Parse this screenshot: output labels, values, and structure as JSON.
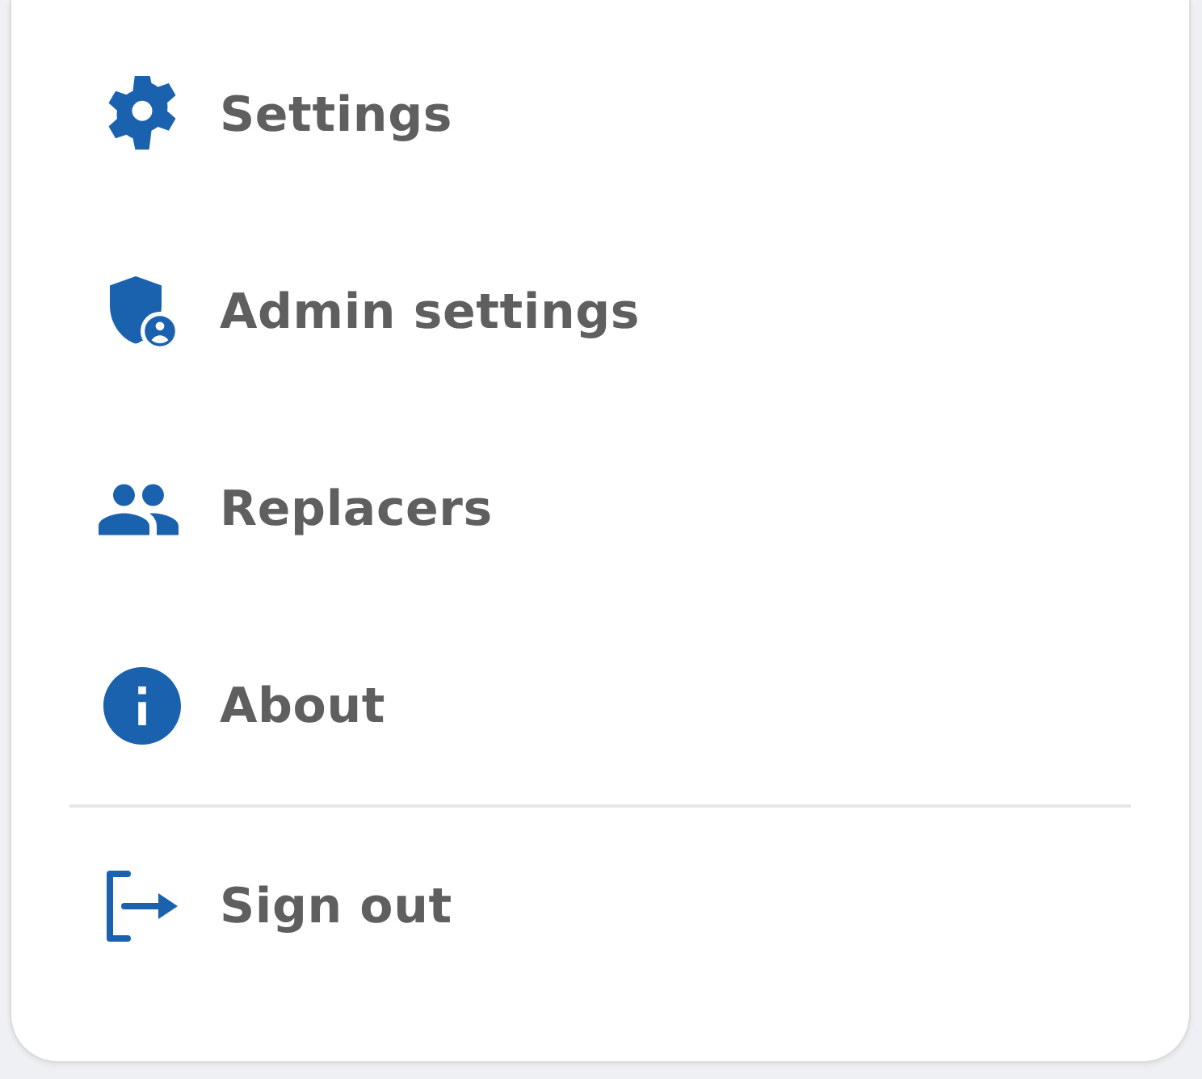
{
  "menu": {
    "sections": [
      {
        "items": [
          {
            "kind": "gear",
            "label": "Settings"
          },
          {
            "kind": "shield-person",
            "label": "Admin settings"
          },
          {
            "kind": "people",
            "label": "Replacers"
          },
          {
            "kind": "info",
            "label": "About"
          }
        ]
      },
      {
        "items": [
          {
            "kind": "sign-out",
            "label": "Sign out"
          }
        ]
      }
    ]
  }
}
